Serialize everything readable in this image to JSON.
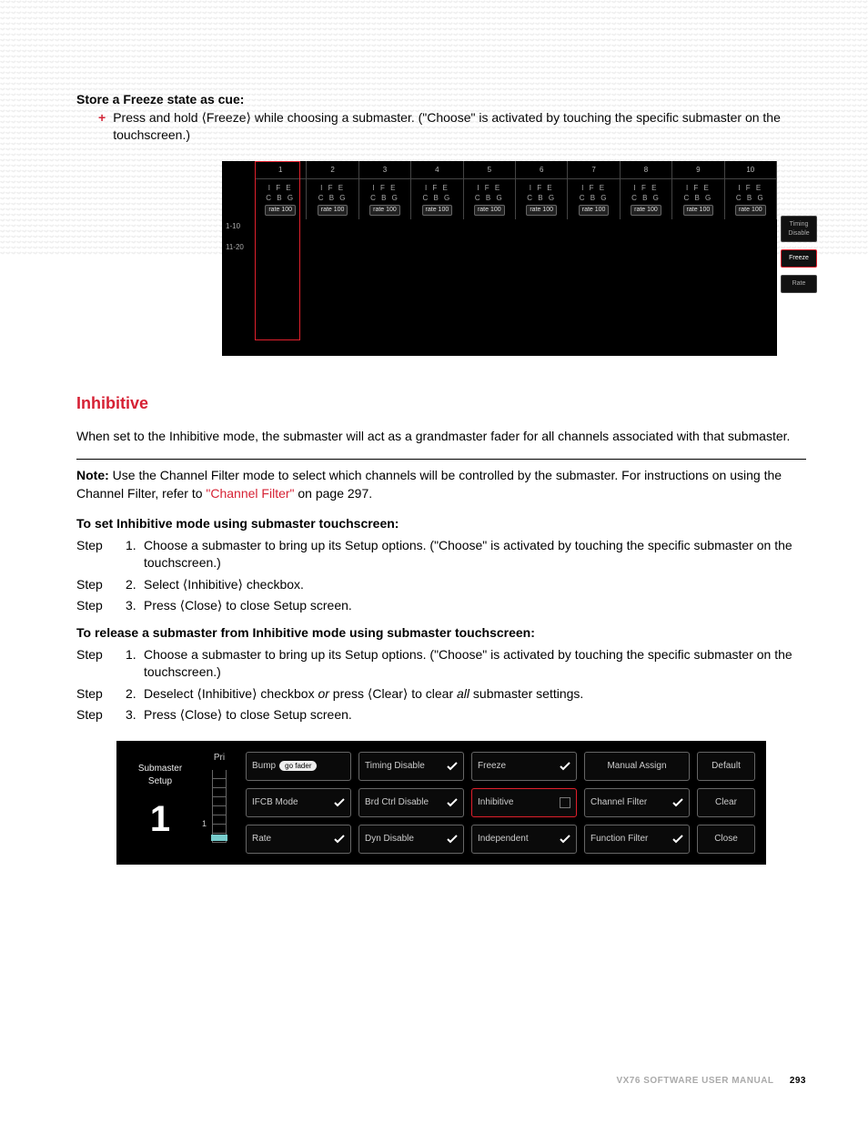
{
  "sec1": {
    "title": "Store a Freeze state as cue:",
    "bullet": "Press and hold ⟨Freeze⟩ while choosing a submaster. (\"Choose\" is activated by touching the specific submaster on the touchscreen.)"
  },
  "shot1": {
    "cols": [
      "1",
      "2",
      "3",
      "4",
      "5",
      "6",
      "7",
      "8",
      "9",
      "10"
    ],
    "cell": {
      "l1": "I  F  E",
      "l2": "C  B  G",
      "rate": "rate 100"
    },
    "range1": "1-10",
    "range2": "11-20",
    "btns": [
      "Timing Disable",
      "Freeze",
      "Rate"
    ]
  },
  "sec2": {
    "title": "Inhibitive",
    "body": "When set to the Inhibitive mode, the submaster will act as a grandmaster fader for all channels associated with that submaster.",
    "noteLabel": "Note:  ",
    "noteA": "Use the Channel Filter mode to select which channels will be controlled by the submaster. For instructions on using the Channel Filter, refer to ",
    "link": "\"Channel Filter\"",
    "noteB": " on page 297."
  },
  "sec3": {
    "title": "To set Inhibitive mode using submaster touchscreen:",
    "steps": [
      {
        "n": "1.",
        "html": "Choose a submaster to bring up its Setup options. (\"Choose\" is activated by touching the specific submaster on the touchscreen.)"
      },
      {
        "n": "2.",
        "html": "Select ⟨Inhibitive⟩ checkbox."
      },
      {
        "n": "3.",
        "html": "Press ⟨Close⟩ to close Setup screen."
      }
    ]
  },
  "sec4": {
    "title": "To release a submaster from Inhibitive mode using submaster touchscreen:",
    "steps": [
      {
        "n": "1.",
        "html": "Choose a submaster to bring up its Setup options. (\"Choose\" is activated by touching the specific submaster on the touchscreen.)"
      },
      {
        "n": "2.",
        "html": "Deselect ⟨Inhibitive⟩ checkbox <i>or</i> press ⟨Clear⟩ to clear <i>all</i> submaster settings."
      },
      {
        "n": "3.",
        "html": "Press ⟨Close⟩ to close Setup screen."
      }
    ]
  },
  "shot2": {
    "sub": "Submaster Setup",
    "num": "1",
    "pri": "Pri",
    "prival": "1",
    "grid": [
      {
        "label": "Bump",
        "pill": "go fader",
        "chk": false,
        "name": "bump"
      },
      {
        "label": "Timing Disable",
        "chk": true,
        "name": "timing-disable"
      },
      {
        "label": "Freeze",
        "chk": true,
        "name": "freeze-option"
      },
      {
        "label": "Manual Assign",
        "center": true,
        "name": "manual-assign"
      },
      {
        "label": "Default",
        "center": true,
        "name": "default"
      },
      {
        "label": "IFCB Mode",
        "chk": true,
        "name": "ifcb-mode"
      },
      {
        "label": "Brd Ctrl Disable",
        "chk": true,
        "name": "brd-ctrl-disable"
      },
      {
        "label": "Inhibitive",
        "chk": false,
        "red": true,
        "box": true,
        "name": "inhibitive-option"
      },
      {
        "label": "Channel Filter",
        "chk": true,
        "name": "channel-filter"
      },
      {
        "label": "Clear",
        "center": true,
        "name": "clear"
      },
      {
        "label": "Rate",
        "chk": true,
        "name": "rate-option"
      },
      {
        "label": "Dyn Disable",
        "chk": true,
        "name": "dyn-disable"
      },
      {
        "label": "Independent",
        "chk": true,
        "name": "independent"
      },
      {
        "label": "Function Filter",
        "chk": true,
        "name": "function-filter"
      },
      {
        "label": "Close",
        "center": true,
        "name": "close"
      }
    ]
  },
  "footer": {
    "manual": "VX76 SOFTWARE USER MANUAL",
    "page": "293"
  },
  "stepLabel": "Step"
}
